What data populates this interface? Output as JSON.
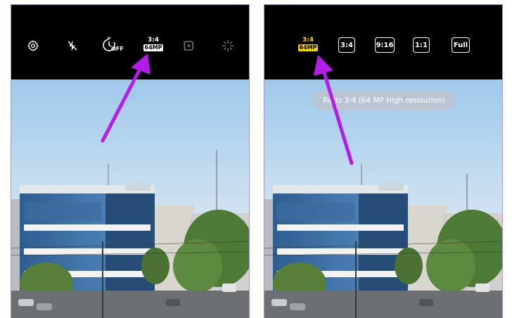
{
  "colors": {
    "toolbar_bg": "#000000",
    "selected_yellow": "#ffd300",
    "annotation_arrow": "#b21ee6",
    "panel_border": "#b98fd8"
  },
  "left_panel": {
    "toolbar": {
      "settings_icon": "gear-icon",
      "flash_icon": "flash-off-icon",
      "timer_icon": "timer-icon",
      "timer_label": "OFF",
      "ratio_label": "3:4",
      "resolution_badge": "64MP",
      "motion_photo_icon": "motion-photo-icon",
      "filter_icon": "sparkle-icon"
    },
    "annotation": "arrow-pointing-to-ratio"
  },
  "right_panel": {
    "toolbar": {
      "selected_ratio_label": "3:4",
      "selected_resolution_badge": "64MP",
      "options": [
        "3:4",
        "9:16",
        "1:1",
        "Full"
      ]
    },
    "toast": "Ratio 3:4 (64 MP High resolution)",
    "annotation": "arrow-pointing-to-selected-ratio"
  }
}
